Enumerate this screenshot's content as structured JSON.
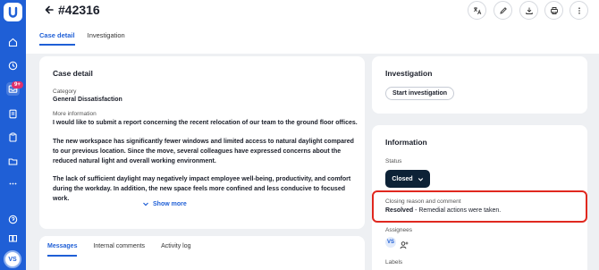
{
  "sidebar": {
    "logo": "brand-logo-icon",
    "badge": "9+",
    "avatar": "VS",
    "items": [
      "home-icon",
      "clock-icon",
      "inbox-icon",
      "report-icon",
      "clipboard-icon",
      "folder-icon",
      "more-icon",
      "help-icon",
      "book-icon"
    ]
  },
  "header": {
    "title": "#42316",
    "actions": [
      "translate-icon",
      "edit-icon",
      "download-icon",
      "print-icon",
      "more-vertical-icon"
    ]
  },
  "tabs": [
    {
      "label": "Case detail",
      "active": true
    },
    {
      "label": "Investigation",
      "active": false
    }
  ],
  "case_detail": {
    "heading": "Case detail",
    "category_label": "Category",
    "category_value": "General Dissatisfaction",
    "more_info_label": "More information",
    "paragraphs": [
      "I would like to submit a report concerning the recent relocation of our team to the ground floor offices.",
      "The new workspace has significantly fewer windows and limited access to natural daylight compared to our previous location. Since the move, several colleagues have expressed concerns about the reduced natural light and overall working environment.",
      "The lack of sufficient daylight may negatively impact employee well-being, productivity, and comfort during the workday. In addition, the new space feels more confined and less conducive to focused work."
    ],
    "show_more": "Show more"
  },
  "bottom_tabs": [
    {
      "label": "Messages",
      "active": true
    },
    {
      "label": "Internal comments",
      "active": false
    },
    {
      "label": "Activity log",
      "active": false
    }
  ],
  "investigation": {
    "heading": "Investigation",
    "start_button": "Start investigation"
  },
  "information": {
    "heading": "Information",
    "status_label": "Status",
    "status_value": "Closed",
    "closing_label": "Closing reason and comment",
    "closing_reason": "Resolved",
    "closing_comment": " - Remedial actions were taken.",
    "assignees_label": "Assignees",
    "assignee_initials": "VS",
    "labels_label": "Labels"
  },
  "colors": {
    "brand": "#1f5fd6",
    "status_button": "#0d2236",
    "highlight": "#e0281f",
    "badge": "#e0306b"
  }
}
